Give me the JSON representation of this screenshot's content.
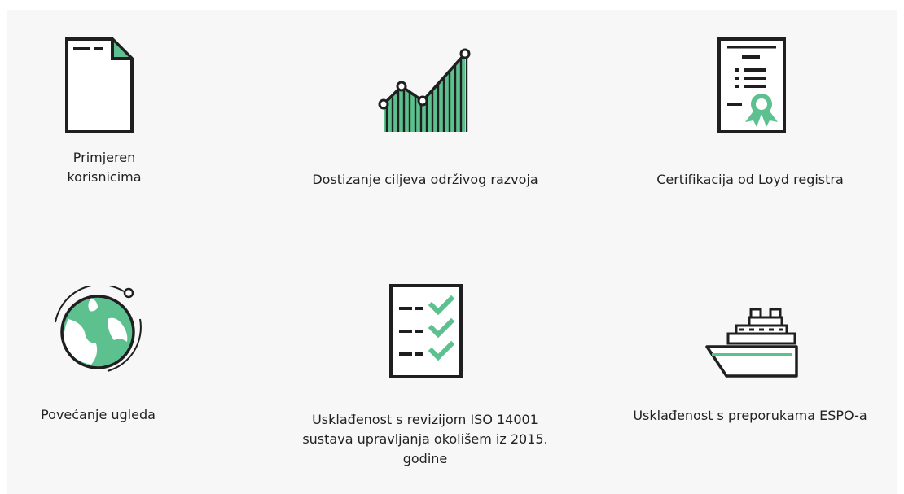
{
  "features": [
    {
      "label_line1": "Primjeren",
      "label_line2": "korisnicima",
      "icon": "document-icon"
    },
    {
      "label_line1": "Dostizanje ciljeva održivog razvoja",
      "icon": "growth-chart-icon"
    },
    {
      "label_line1": "Certifikacija od Loyd registra",
      "icon": "certificate-icon"
    },
    {
      "label_line1": "Povećanje ugleda",
      "icon": "globe-orbit-icon"
    },
    {
      "label_line1": "Usklađenost s revizijom ISO 14001",
      "label_line2": "sustava upravljanja okolišem iz 2015.",
      "label_line3": "godine",
      "icon": "checklist-icon"
    },
    {
      "label_line1": "Usklađenost s preporukama ESPO-a",
      "icon": "ship-icon"
    }
  ],
  "colors": {
    "accent": "#5cc08f",
    "stroke": "#1f1f1f",
    "panel": "#f7f7f7"
  }
}
